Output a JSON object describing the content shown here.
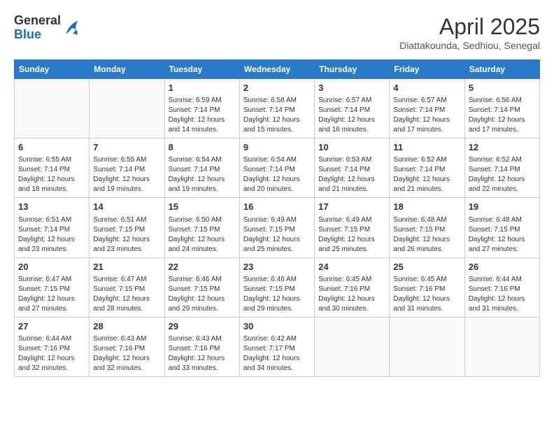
{
  "header": {
    "logo": {
      "general": "General",
      "blue": "Blue"
    },
    "title": "April 2025",
    "location": "Diattakounda, Sedhiou, Senegal"
  },
  "weekdays": [
    "Sunday",
    "Monday",
    "Tuesday",
    "Wednesday",
    "Thursday",
    "Friday",
    "Saturday"
  ],
  "weeks": [
    [
      {
        "day": null
      },
      {
        "day": null
      },
      {
        "day": "1",
        "sunrise": "6:59 AM",
        "sunset": "7:14 PM",
        "daylight": "12 hours and 14 minutes."
      },
      {
        "day": "2",
        "sunrise": "6:58 AM",
        "sunset": "7:14 PM",
        "daylight": "12 hours and 15 minutes."
      },
      {
        "day": "3",
        "sunrise": "6:57 AM",
        "sunset": "7:14 PM",
        "daylight": "12 hours and 16 minutes."
      },
      {
        "day": "4",
        "sunrise": "6:57 AM",
        "sunset": "7:14 PM",
        "daylight": "12 hours and 17 minutes."
      },
      {
        "day": "5",
        "sunrise": "6:56 AM",
        "sunset": "7:14 PM",
        "daylight": "12 hours and 17 minutes."
      }
    ],
    [
      {
        "day": "6",
        "sunrise": "6:55 AM",
        "sunset": "7:14 PM",
        "daylight": "12 hours and 18 minutes."
      },
      {
        "day": "7",
        "sunrise": "6:55 AM",
        "sunset": "7:14 PM",
        "daylight": "12 hours and 19 minutes."
      },
      {
        "day": "8",
        "sunrise": "6:54 AM",
        "sunset": "7:14 PM",
        "daylight": "12 hours and 19 minutes."
      },
      {
        "day": "9",
        "sunrise": "6:54 AM",
        "sunset": "7:14 PM",
        "daylight": "12 hours and 20 minutes."
      },
      {
        "day": "10",
        "sunrise": "6:53 AM",
        "sunset": "7:14 PM",
        "daylight": "12 hours and 21 minutes."
      },
      {
        "day": "11",
        "sunrise": "6:52 AM",
        "sunset": "7:14 PM",
        "daylight": "12 hours and 21 minutes."
      },
      {
        "day": "12",
        "sunrise": "6:52 AM",
        "sunset": "7:14 PM",
        "daylight": "12 hours and 22 minutes."
      }
    ],
    [
      {
        "day": "13",
        "sunrise": "6:51 AM",
        "sunset": "7:14 PM",
        "daylight": "12 hours and 23 minutes."
      },
      {
        "day": "14",
        "sunrise": "6:51 AM",
        "sunset": "7:15 PM",
        "daylight": "12 hours and 23 minutes."
      },
      {
        "day": "15",
        "sunrise": "6:50 AM",
        "sunset": "7:15 PM",
        "daylight": "12 hours and 24 minutes."
      },
      {
        "day": "16",
        "sunrise": "6:49 AM",
        "sunset": "7:15 PM",
        "daylight": "12 hours and 25 minutes."
      },
      {
        "day": "17",
        "sunrise": "6:49 AM",
        "sunset": "7:15 PM",
        "daylight": "12 hours and 25 minutes."
      },
      {
        "day": "18",
        "sunrise": "6:48 AM",
        "sunset": "7:15 PM",
        "daylight": "12 hours and 26 minutes."
      },
      {
        "day": "19",
        "sunrise": "6:48 AM",
        "sunset": "7:15 PM",
        "daylight": "12 hours and 27 minutes."
      }
    ],
    [
      {
        "day": "20",
        "sunrise": "6:47 AM",
        "sunset": "7:15 PM",
        "daylight": "12 hours and 27 minutes."
      },
      {
        "day": "21",
        "sunrise": "6:47 AM",
        "sunset": "7:15 PM",
        "daylight": "12 hours and 28 minutes."
      },
      {
        "day": "22",
        "sunrise": "6:46 AM",
        "sunset": "7:15 PM",
        "daylight": "12 hours and 29 minutes."
      },
      {
        "day": "23",
        "sunrise": "6:46 AM",
        "sunset": "7:15 PM",
        "daylight": "12 hours and 29 minutes."
      },
      {
        "day": "24",
        "sunrise": "6:45 AM",
        "sunset": "7:16 PM",
        "daylight": "12 hours and 30 minutes."
      },
      {
        "day": "25",
        "sunrise": "6:45 AM",
        "sunset": "7:16 PM",
        "daylight": "12 hours and 31 minutes."
      },
      {
        "day": "26",
        "sunrise": "6:44 AM",
        "sunset": "7:16 PM",
        "daylight": "12 hours and 31 minutes."
      }
    ],
    [
      {
        "day": "27",
        "sunrise": "6:44 AM",
        "sunset": "7:16 PM",
        "daylight": "12 hours and 32 minutes."
      },
      {
        "day": "28",
        "sunrise": "6:43 AM",
        "sunset": "7:16 PM",
        "daylight": "12 hours and 32 minutes."
      },
      {
        "day": "29",
        "sunrise": "6:43 AM",
        "sunset": "7:16 PM",
        "daylight": "12 hours and 33 minutes."
      },
      {
        "day": "30",
        "sunrise": "6:42 AM",
        "sunset": "7:17 PM",
        "daylight": "12 hours and 34 minutes."
      },
      {
        "day": null
      },
      {
        "day": null
      },
      {
        "day": null
      }
    ]
  ]
}
